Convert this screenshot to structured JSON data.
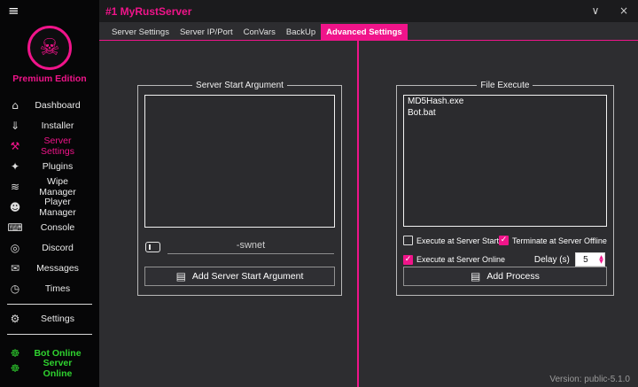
{
  "titlebar": {
    "title": "#1 MyRustServer",
    "menu_glyph": "≡",
    "collapse_glyph": "∨",
    "close_glyph": "×"
  },
  "sidebar": {
    "logo_glyph": "☠",
    "edition": "Premium Edition",
    "items": [
      {
        "label": "Dashboard",
        "icon": "dashboard-icon",
        "glyph": "⌂"
      },
      {
        "label": "Installer",
        "icon": "installer-icon",
        "glyph": "⇓"
      },
      {
        "label": "Server Settings",
        "icon": "wrench-icon",
        "glyph": "⚒"
      },
      {
        "label": "Plugins",
        "icon": "plugins-icon",
        "glyph": "✦"
      },
      {
        "label": "Wipe Manager",
        "icon": "wipe-icon",
        "glyph": "≋"
      },
      {
        "label": "Player Manager",
        "icon": "player-icon",
        "glyph": "☻"
      },
      {
        "label": "Console",
        "icon": "console-icon",
        "glyph": "⌨"
      },
      {
        "label": "Discord",
        "icon": "discord-icon",
        "glyph": "◎"
      },
      {
        "label": "Messages",
        "icon": "messages-icon",
        "glyph": "✉"
      },
      {
        "label": "Times",
        "icon": "clock-icon",
        "glyph": "◷"
      }
    ],
    "settings": {
      "label": "Settings",
      "glyph": "⚙"
    },
    "status": [
      {
        "label": "Bot Online",
        "glyph": "☸"
      },
      {
        "label": "Server Online",
        "glyph": "☸"
      }
    ]
  },
  "tabs": [
    {
      "label": "Server Settings"
    },
    {
      "label": "Server IP/Port"
    },
    {
      "label": "ConVars"
    },
    {
      "label": "BackUp"
    },
    {
      "label": "Advanced Settings"
    }
  ],
  "panels": {
    "start_arg": {
      "title": "Server Start Argument",
      "items": [],
      "input_value": "-swnet",
      "button_label": "Add Server Start Argument"
    },
    "file_execute": {
      "title": "File Execute",
      "items": [
        "MD5Hash.exe",
        "Bot.bat"
      ],
      "checkboxes": [
        {
          "label": "Execute at Server Start",
          "checked": false
        },
        {
          "label": "Terminate at Server Offline",
          "checked": true
        },
        {
          "label": "Execute at Server Online",
          "checked": true
        }
      ],
      "delay_label": "Delay (s)",
      "delay_value": "5",
      "button_label": "Add Process"
    }
  },
  "icons": {
    "form_glyph": "▤",
    "check_glyph": "✓",
    "spin_up_glyph": "▲",
    "spin_down_glyph": "▼"
  },
  "footer": {
    "version": "Version:  public-5.1.0"
  },
  "colors": {
    "accent": "#f0148a",
    "online_green": "#2fd32f",
    "background": "#2d2d30",
    "sidebar": "#060607"
  }
}
